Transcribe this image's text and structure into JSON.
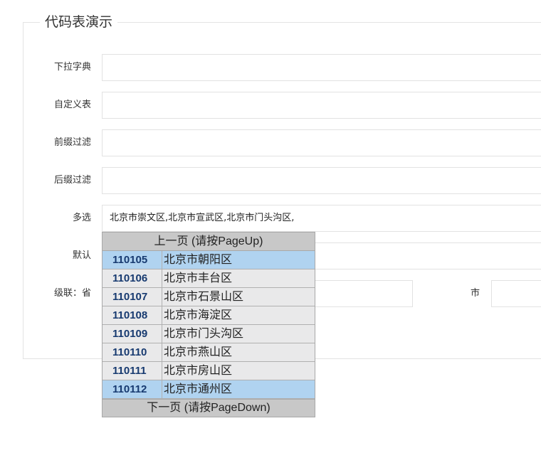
{
  "legend": "代码表演示",
  "rows": {
    "dict": {
      "label": "下拉字典",
      "value": ""
    },
    "custom": {
      "label": "自定义表",
      "value": ""
    },
    "prefix": {
      "label": "前缀过滤",
      "value": ""
    },
    "suffix": {
      "label": "后缀过滤",
      "value": ""
    },
    "multi": {
      "label": "多选",
      "value": "北京市崇文区,北京市宣武区,北京市门头沟区,"
    },
    "default": {
      "label": "默认",
      "value": ""
    },
    "cascade": {
      "label": "级联：省",
      "value": "",
      "city_label": "市",
      "city_value": ""
    }
  },
  "dropdown": {
    "prev": "上一页 (请按PageUp)",
    "next": "下一页 (请按PageDown)",
    "items": [
      {
        "code": "110105",
        "name": "北京市朝阳区",
        "selected": true
      },
      {
        "code": "110106",
        "name": "北京市丰台区",
        "selected": false
      },
      {
        "code": "110107",
        "name": "北京市石景山区",
        "selected": false
      },
      {
        "code": "110108",
        "name": "北京市海淀区",
        "selected": false
      },
      {
        "code": "110109",
        "name": "北京市门头沟区",
        "selected": false
      },
      {
        "code": "110110",
        "name": "北京市燕山区",
        "selected": false
      },
      {
        "code": "110111",
        "name": "北京市房山区",
        "selected": false
      },
      {
        "code": "110112",
        "name": "北京市通州区",
        "selected": true
      }
    ]
  }
}
